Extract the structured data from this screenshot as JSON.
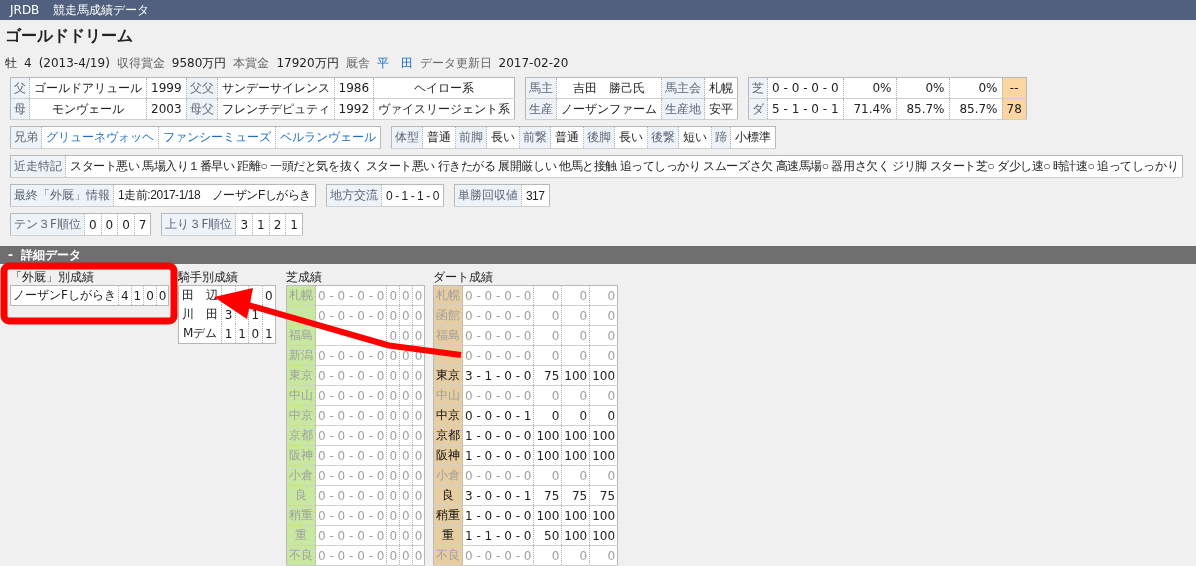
{
  "app_bar": {
    "logo": "JRDB",
    "title": "競走馬成績データ"
  },
  "horse": {
    "name": "ゴールドドリーム"
  },
  "summary": [
    {
      "kind": "value",
      "text": "牡"
    },
    {
      "kind": "value",
      "text": "4"
    },
    {
      "kind": "value",
      "text": "(2013-4/19)"
    },
    {
      "kind": "label",
      "text": "収得賞金"
    },
    {
      "kind": "value",
      "text": "9580万円"
    },
    {
      "kind": "label",
      "text": "本賞金"
    },
    {
      "kind": "value",
      "text": "17920万円"
    },
    {
      "kind": "label",
      "text": "厩舎"
    },
    {
      "kind": "link",
      "text": "平　田"
    },
    {
      "kind": "label",
      "text": "データ更新日"
    },
    {
      "kind": "value",
      "text": "2017-02-20"
    }
  ],
  "info_lines": [
    [
      {
        "rows": [
          [
            {
              "kind": "label",
              "text": "父"
            },
            {
              "kind": "value",
              "text": "ゴールドアリュール"
            },
            {
              "kind": "num",
              "text": "1999"
            },
            {
              "kind": "label",
              "text": "父父"
            },
            {
              "kind": "value",
              "text": "サンデーサイレンス"
            },
            {
              "kind": "num",
              "text": "1986"
            },
            {
              "kind": "wide",
              "text": "ヘイロー系"
            }
          ],
          [
            {
              "kind": "label",
              "text": "母"
            },
            {
              "kind": "value",
              "text": "モンヴェール"
            },
            {
              "kind": "num",
              "text": "2003"
            },
            {
              "kind": "label",
              "text": "母父"
            },
            {
              "kind": "value",
              "text": "フレンチデピュティ"
            },
            {
              "kind": "num",
              "text": "1992"
            },
            {
              "kind": "wide",
              "text": "ヴァイスリージェント系"
            }
          ]
        ]
      },
      {
        "rows": [
          [
            {
              "kind": "label",
              "text": "馬主"
            },
            {
              "kind": "value",
              "text": "吉田　勝己氏"
            },
            {
              "kind": "label",
              "text": "馬主会"
            },
            {
              "kind": "value",
              "text": "札幌"
            }
          ],
          [
            {
              "kind": "label",
              "text": "生産"
            },
            {
              "kind": "value",
              "text": "ノーザンファーム"
            },
            {
              "kind": "label",
              "text": "生産地"
            },
            {
              "kind": "value",
              "text": "安平"
            }
          ]
        ]
      },
      {
        "rows": [
          [
            {
              "kind": "label",
              "text": "芝"
            },
            {
              "kind": "value",
              "text": "0 - 0 - 0 - 0"
            },
            {
              "kind": "pct",
              "text": "0%"
            },
            {
              "kind": "pct",
              "text": "0%"
            },
            {
              "kind": "pct",
              "text": "0%"
            },
            {
              "kind": "highlight",
              "text": "--"
            }
          ],
          [
            {
              "kind": "label",
              "text": "ダ"
            },
            {
              "kind": "value",
              "text": "5 - 1 - 0 - 1"
            },
            {
              "kind": "pct",
              "text": "71.4%"
            },
            {
              "kind": "pct",
              "text": "85.7%"
            },
            {
              "kind": "pct",
              "text": "85.7%"
            },
            {
              "kind": "highlight",
              "text": "78"
            }
          ]
        ]
      }
    ],
    [
      {
        "rows": [
          [
            {
              "kind": "label",
              "text": "兄弟"
            },
            {
              "kind": "link",
              "text": "グリューネヴォッヘ"
            },
            {
              "kind": "link",
              "text": "ファンシーミューズ"
            },
            {
              "kind": "link",
              "text": "ベルランヴェール"
            }
          ]
        ]
      },
      {
        "rows": [
          [
            {
              "kind": "label",
              "text": "体型"
            },
            {
              "kind": "value",
              "text": "普通"
            },
            {
              "kind": "label",
              "text": "前脚"
            },
            {
              "kind": "value",
              "text": "長い"
            },
            {
              "kind": "label",
              "text": "前繋"
            },
            {
              "kind": "value",
              "text": "普通"
            },
            {
              "kind": "label",
              "text": "後脚"
            },
            {
              "kind": "value",
              "text": "長い"
            },
            {
              "kind": "label",
              "text": "後繋"
            },
            {
              "kind": "value",
              "text": "短い"
            },
            {
              "kind": "label",
              "text": "蹄"
            },
            {
              "kind": "value",
              "text": "小標準"
            }
          ]
        ]
      }
    ],
    [
      {
        "rows": [
          [
            {
              "kind": "label",
              "text": "近走特記"
            },
            {
              "kind": "text",
              "text": "スタート悪い 馬場入り１番早い 距離○ 一頭だと気を抜く スタート悪い 行きたがる 展開厳しい 他馬と接触 追ってしっかり スムーズさ欠 高速馬場○ 器用さ欠く ジリ脚 スタート芝○ ダ少し速○ 時計速○ 追ってしっかり"
            }
          ]
        ]
      }
    ],
    [
      {
        "rows": [
          [
            {
              "kind": "label",
              "text": "最終「外厩」情報"
            },
            {
              "kind": "text",
              "text": "1走前:2017-1/18　ノーザンFしがらき"
            }
          ]
        ]
      },
      {
        "rows": [
          [
            {
              "kind": "label",
              "text": "地方交流"
            },
            {
              "kind": "text",
              "text": "0 - 1 - 1 - 0"
            }
          ]
        ]
      },
      {
        "rows": [
          [
            {
              "kind": "label",
              "text": "単勝回収値"
            },
            {
              "kind": "text",
              "text": "317"
            }
          ]
        ]
      }
    ],
    [
      {
        "rows": [
          [
            {
              "kind": "label",
              "text": "テン３F順位"
            },
            {
              "kind": "num",
              "text": "0"
            },
            {
              "kind": "num",
              "text": "0"
            },
            {
              "kind": "num",
              "text": "0"
            },
            {
              "kind": "num",
              "text": "7"
            }
          ]
        ]
      },
      {
        "rows": [
          [
            {
              "kind": "label",
              "text": "上り３F順位"
            },
            {
              "kind": "num",
              "text": "3"
            },
            {
              "kind": "num",
              "text": "1"
            },
            {
              "kind": "num",
              "text": "2"
            },
            {
              "kind": "num",
              "text": "1"
            }
          ]
        ]
      }
    ]
  ],
  "section": {
    "toggle": "-",
    "title": "詳細データ"
  },
  "panels": [
    {
      "title": "「外厩」別成績",
      "kind": "plain",
      "rows": [
        {
          "cells": [
            "ノーザンFしがらき",
            "4",
            "1",
            "0",
            "0"
          ]
        }
      ]
    },
    {
      "title": "騎手別成績",
      "kind": "plain",
      "rows": [
        {
          "cells": [
            "田　辺",
            null,
            null,
            null,
            "0"
          ]
        },
        {
          "cells": [
            "川　田",
            "3",
            null,
            "1",
            null
          ]
        },
        {
          "cells": [
            "Mデム",
            "1",
            "1",
            "0",
            "1"
          ]
        }
      ]
    },
    {
      "title": "芝成績",
      "kind": "turf",
      "rows": [
        {
          "active": false,
          "cells": [
            "札幌",
            "0 - 0 - 0 - 0",
            "0",
            "0",
            "0"
          ]
        },
        {
          "active": false,
          "cells": [
            null,
            "0 - 0 - 0 - 0",
            "0",
            "0",
            "0"
          ]
        },
        {
          "active": false,
          "cells": [
            "福島",
            null,
            "0",
            "0",
            "0"
          ]
        },
        {
          "active": false,
          "cells": [
            "新潟",
            "0 - 0 - 0 - 0",
            "0",
            "0",
            "0"
          ]
        },
        {
          "active": false,
          "cells": [
            "東京",
            "0 - 0 - 0 - 0",
            "0",
            "0",
            "0"
          ]
        },
        {
          "active": false,
          "cells": [
            "中山",
            "0 - 0 - 0 - 0",
            "0",
            "0",
            "0"
          ]
        },
        {
          "active": false,
          "cells": [
            "中京",
            "0 - 0 - 0 - 0",
            "0",
            "0",
            "0"
          ]
        },
        {
          "active": false,
          "cells": [
            "京都",
            "0 - 0 - 0 - 0",
            "0",
            "0",
            "0"
          ]
        },
        {
          "active": false,
          "cells": [
            "阪神",
            "0 - 0 - 0 - 0",
            "0",
            "0",
            "0"
          ]
        },
        {
          "active": false,
          "cells": [
            "小倉",
            "0 - 0 - 0 - 0",
            "0",
            "0",
            "0"
          ]
        },
        {
          "active": false,
          "cells": [
            "良",
            "0 - 0 - 0 - 0",
            "0",
            "0",
            "0"
          ]
        },
        {
          "active": false,
          "cells": [
            "稍重",
            "0 - 0 - 0 - 0",
            "0",
            "0",
            "0"
          ]
        },
        {
          "active": false,
          "cells": [
            "重",
            "0 - 0 - 0 - 0",
            "0",
            "0",
            "0"
          ]
        },
        {
          "active": false,
          "cells": [
            "不良",
            "0 - 0 - 0 - 0",
            "0",
            "0",
            "0"
          ]
        }
      ]
    },
    {
      "title": "ダート成績",
      "kind": "dirt",
      "rows": [
        {
          "active": false,
          "cells": [
            "札幌",
            "0 - 0 - 0 - 0",
            "0",
            "0",
            "0"
          ]
        },
        {
          "active": false,
          "cells": [
            "函館",
            "0 - 0 - 0 - 0",
            "0",
            "0",
            "0"
          ]
        },
        {
          "active": false,
          "cells": [
            "福島",
            "0 - 0 - 0 - 0",
            "0",
            "0",
            "0"
          ]
        },
        {
          "active": false,
          "cells": [
            null,
            "0 - 0 - 0 - 0",
            "0",
            "0",
            "0"
          ]
        },
        {
          "active": true,
          "cells": [
            "東京",
            "3 - 1 - 0 - 0",
            "75",
            "100",
            "100"
          ]
        },
        {
          "active": false,
          "cells": [
            "中山",
            "0 - 0 - 0 - 0",
            "0",
            "0",
            "0"
          ]
        },
        {
          "active": true,
          "cells": [
            "中京",
            "0 - 0 - 0 - 1",
            "0",
            "0",
            "0"
          ]
        },
        {
          "active": true,
          "cells": [
            "京都",
            "1 - 0 - 0 - 0",
            "100",
            "100",
            "100"
          ]
        },
        {
          "active": true,
          "cells": [
            "阪神",
            "1 - 0 - 0 - 0",
            "100",
            "100",
            "100"
          ]
        },
        {
          "active": false,
          "cells": [
            "小倉",
            "0 - 0 - 0 - 0",
            "0",
            "0",
            "0"
          ]
        },
        {
          "active": true,
          "cells": [
            "良",
            "3 - 0 - 0 - 1",
            "75",
            "75",
            "75"
          ]
        },
        {
          "active": true,
          "cells": [
            "稍重",
            "1 - 0 - 0 - 0",
            "100",
            "100",
            "100"
          ]
        },
        {
          "active": true,
          "cells": [
            "重",
            "1 - 1 - 0 - 0",
            "50",
            "100",
            "100"
          ]
        },
        {
          "active": false,
          "cells": [
            "不良",
            "0 - 0 - 0 - 0",
            "0",
            "0",
            "0"
          ]
        }
      ]
    }
  ]
}
